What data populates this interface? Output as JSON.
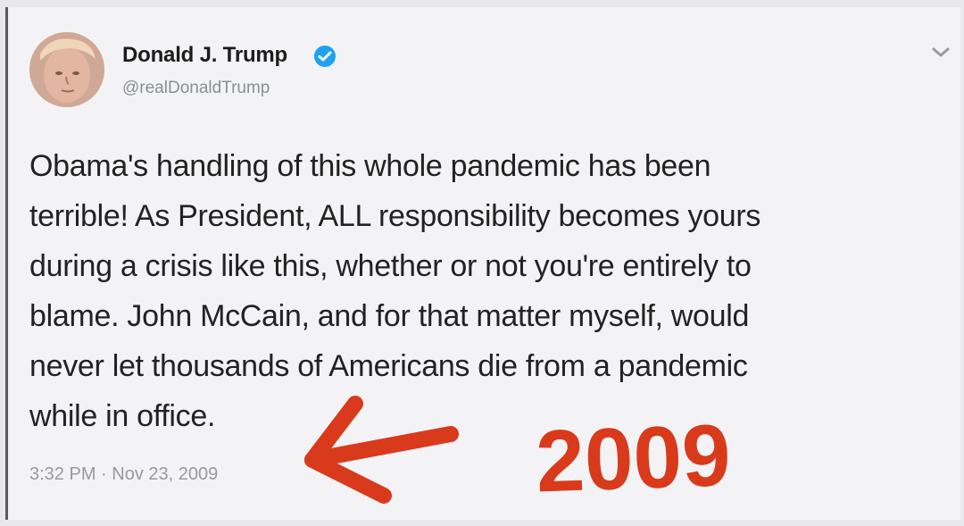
{
  "tweet": {
    "author_name": "Donald J. Trump",
    "handle": "@realDonaldTrump",
    "verified_icon": "verified-badge-icon",
    "more_icon": "chevron-down-icon",
    "text_lines": [
      "Obama's handling of this whole pandemic has been",
      "terrible! As President, ALL responsibility becomes yours",
      "during a crisis like this, whether or not you're entirely to",
      "blame. John McCain, and for that matter myself, would",
      "never let thousands of Americans die from a pandemic",
      "while in office."
    ],
    "timestamp": "3:32 PM · Nov 23, 2009"
  },
  "annotation": {
    "handwritten_year": "2009",
    "arrow_icon": "hand-drawn-arrow-left-icon",
    "color": "#d93a1c"
  },
  "colors": {
    "verified": "#1da1f2",
    "text": "#222222",
    "muted": "#8a8f95",
    "annotation": "#d93a1c"
  }
}
